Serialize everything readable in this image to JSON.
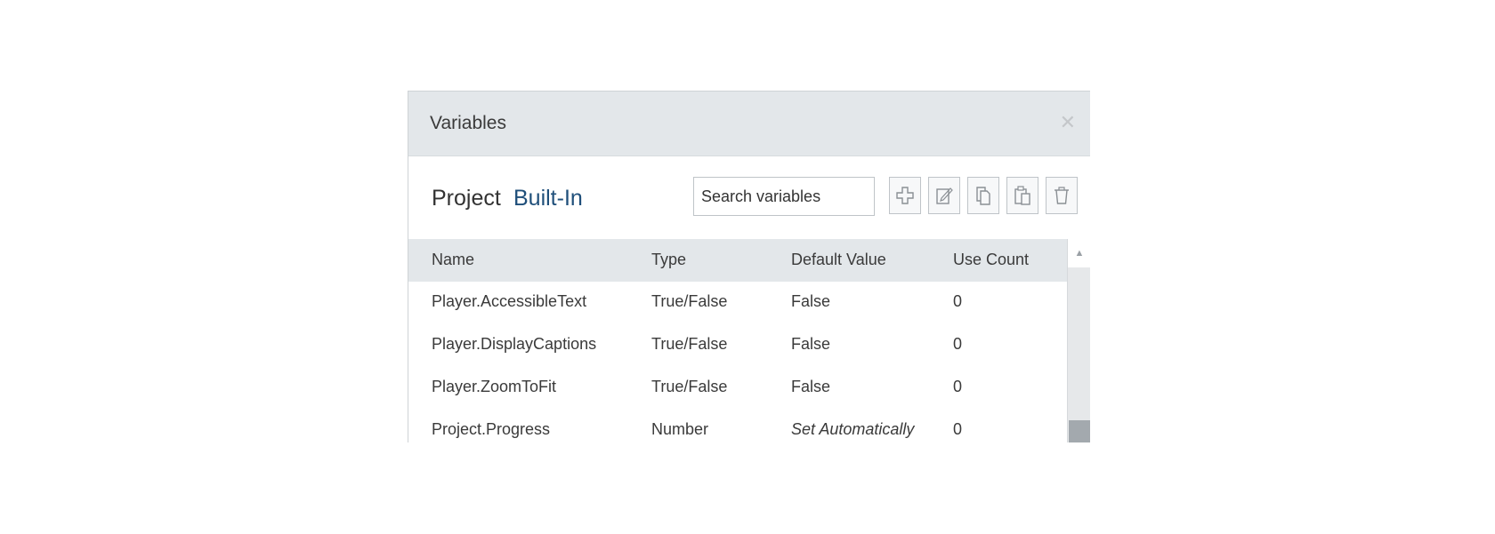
{
  "dialog": {
    "title": "Variables",
    "close_icon": "close-icon"
  },
  "tabs": [
    {
      "label": "Project",
      "active": false
    },
    {
      "label": "Built-In",
      "active": true
    }
  ],
  "search": {
    "placeholder": "Search variables"
  },
  "toolbar": {
    "icons": [
      "add-icon",
      "edit-icon",
      "copy-icon",
      "paste-icon",
      "delete-icon"
    ]
  },
  "table": {
    "columns": [
      "Name",
      "Type",
      "Default Value",
      "Use Count"
    ],
    "rows": [
      {
        "name": "Player.AccessibleText",
        "type": "True/False",
        "default": "False",
        "use_count": "0"
      },
      {
        "name": "Player.DisplayCaptions",
        "type": "True/False",
        "default": "False",
        "use_count": "0"
      },
      {
        "name": "Player.ZoomToFit",
        "type": "True/False",
        "default": "False",
        "use_count": "0"
      },
      {
        "name": "Project.Progress",
        "type": "Number",
        "default": "Set Automatically",
        "use_count": "0"
      }
    ]
  },
  "colors": {
    "titlebar": "#e3e7ea",
    "active_tab": "#1f4f7a",
    "text": "#3a3a3a"
  }
}
